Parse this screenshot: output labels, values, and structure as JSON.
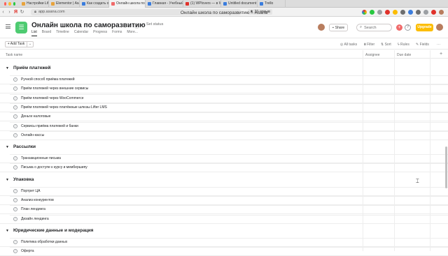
{
  "browser": {
    "tabs": [
      {
        "label": "Настройки LifterLMS",
        "color": "#e8a33d"
      },
      {
        "label": "Elementor | Asaf",
        "color": "#e8a33d"
      },
      {
        "label": "Как создать онлайн-ш",
        "color": "#3b7ddd"
      },
      {
        "label": "Онлайн школа по само",
        "color": "#f06a6a",
        "active": true
      },
      {
        "label": "Главная - Учебный ц...",
        "color": "#3b7ddd"
      },
      {
        "label": "(1) WPlovers — в Word",
        "color": "#e0322b"
      },
      {
        "label": "Untitled document - Go",
        "color": "#3b7ddd"
      },
      {
        "label": "Trello",
        "color": "#3b7ddd"
      }
    ],
    "url": "app.asana.com",
    "yandex_logo": "Я",
    "rating": "★ 21 отзыв"
  },
  "window_title": "Онлайн школа по саморазвитию – Asana",
  "header": {
    "project_name": "Онлайн школа по саморазвитию",
    "set_status": "Set status",
    "nav_tabs": [
      "List",
      "Board",
      "Timeline",
      "Calendar",
      "Progress",
      "Forms",
      "More..."
    ],
    "share_label": "Share",
    "search_label": "Search",
    "upgrade_label": "Upgrade",
    "help_label": "?",
    "plus_label": "+"
  },
  "toolbar": {
    "add_task": "+ Add Task",
    "all_tasks": "All tasks",
    "filter": "Filter",
    "sort": "Sort",
    "rules": "Rules",
    "fields": "Fields"
  },
  "columns": {
    "task_name": "Task name",
    "assignee": "Assignee",
    "due_date": "Due date"
  },
  "sections": [
    {
      "name": "Приём платежей",
      "tasks": [
        "Ручной способ приёма платежей",
        "Приём платежей через внешние сервисы",
        "Приём платежей через WooCommerce",
        "Приём платежей через платёжные шлюзы Lifter LMS",
        "Деньги налоговые",
        "Сервисы приёма платежей и банки",
        "Онлайн-кассы"
      ]
    },
    {
      "name": "Рассылки",
      "tasks": [
        "Транзакционные письма",
        "Письма о доступе к курсу и мембершипу"
      ]
    },
    {
      "name": "Упаковка",
      "tasks": [
        "Портрет ЦА",
        "Анализ конкурентов",
        "План лендинга",
        "Дизайн лендинга"
      ]
    },
    {
      "name": "Юридические данные и модерация",
      "tasks": [
        "Политика обработки данных",
        "Оферта"
      ]
    }
  ]
}
